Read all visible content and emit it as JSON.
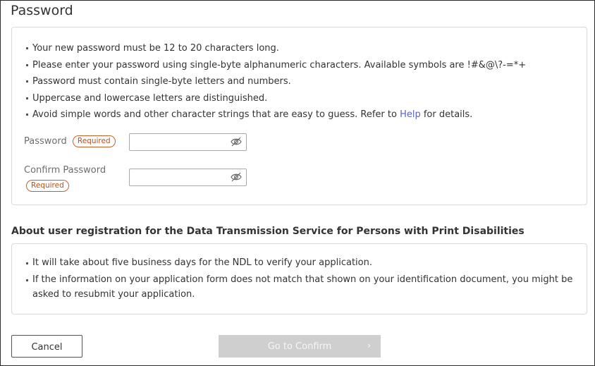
{
  "page": {
    "title": "Password"
  },
  "password_rules": [
    "Your new password must be 12 to 20 characters long.",
    "Please enter your password using single-byte alphanumeric characters. Available symbols are !#&@\\?-=*+",
    "Password must contain single-byte letters and numbers.",
    "Uppercase and lowercase letters are distinguished."
  ],
  "password_rule_last": {
    "before": "Avoid simple words and other character strings that are easy to guess. Refer to ",
    "link": "Help",
    "after": " for details."
  },
  "fields": {
    "password_label": "Password",
    "confirm_label": "Confirm Password",
    "required_badge": "Required",
    "password_value": "",
    "confirm_value": ""
  },
  "about": {
    "heading": "About user registration for the Data Transmission Service for Persons with Print Disabilities",
    "items": [
      "It will take about five business days for the NDL to verify your application.",
      "If the information on your application form does not match that shown on your identification document, you might be asked to resubmit your application."
    ]
  },
  "buttons": {
    "cancel": "Cancel",
    "confirm": "Go to Confirm",
    "confirm_chevron": "›"
  },
  "icons": {
    "visibility_toggle": "eye-slash-icon"
  },
  "colors": {
    "required": "#c5622a",
    "link": "#5b5fc7",
    "disabled_button": "#cfcfcf"
  }
}
